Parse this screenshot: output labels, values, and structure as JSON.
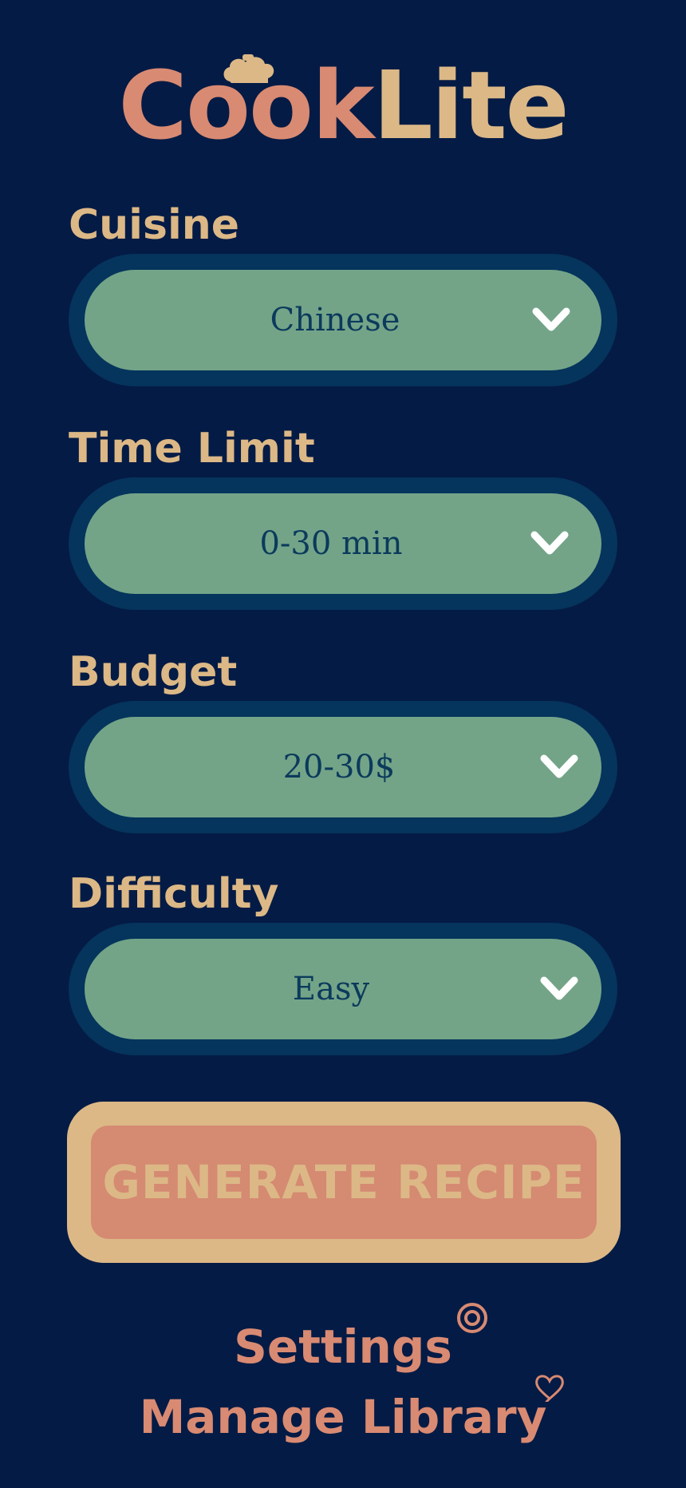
{
  "app": {
    "title_part1": "Cook",
    "title_part2": "Lite"
  },
  "form": {
    "fields": [
      {
        "label": "Cuisine",
        "value": "Chinese"
      },
      {
        "label": "Time Limit",
        "value": "0-30 min"
      },
      {
        "label": "Budget",
        "value": "20-30$"
      },
      {
        "label": "Difficulty",
        "value": "Easy"
      }
    ]
  },
  "actions": {
    "generate_label": "GENERATE RECIPE"
  },
  "footer": {
    "settings_label": "Settings",
    "library_label": "Manage Library"
  },
  "icons": {
    "logo_accent": "chef-hat-icon",
    "dropdown": "chevron-down-icon",
    "settings": "gear-icon",
    "library": "heart-icon"
  },
  "colors": {
    "background": "#041b45",
    "accent_salmon": "#d98a72",
    "accent_sand": "#dcb886",
    "select_fill": "#73a488",
    "select_ring": "#05345c",
    "select_text": "#0c3a5c"
  }
}
